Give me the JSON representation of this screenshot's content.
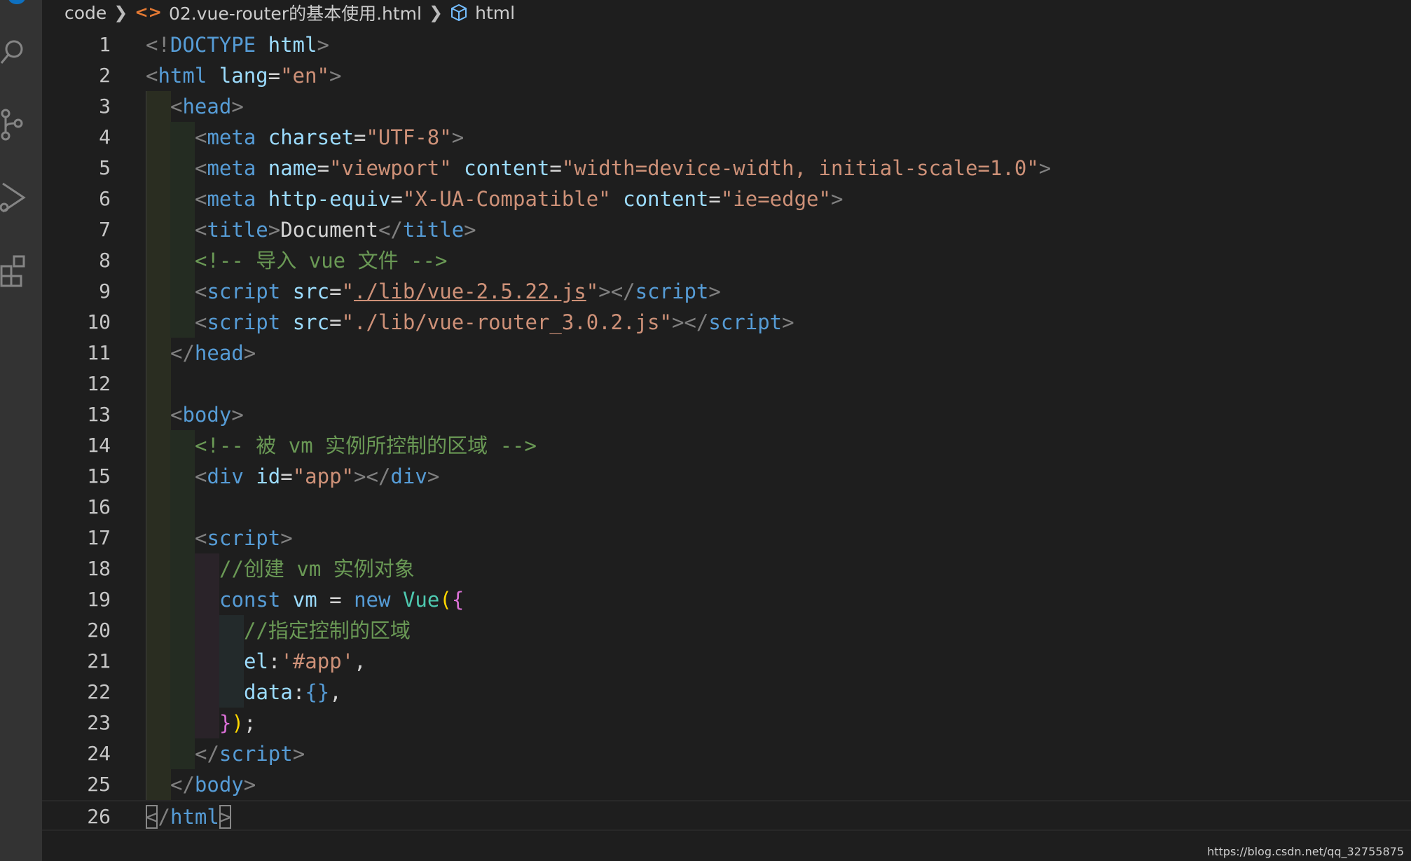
{
  "breadcrumb": {
    "root": "code",
    "file": "02.vue-router的基本使用.html",
    "symbol": "html"
  },
  "icons": {
    "file_icon": "code-bracket-icon",
    "symbol_icon": "cube-icon",
    "activity": [
      "search-icon",
      "source-control-icon",
      "run-debug-icon",
      "extensions-icon"
    ]
  },
  "colors": {
    "background": "#1e1e1e",
    "tag": "#569cd6",
    "attribute": "#9cdcfe",
    "string": "#ce9178",
    "comment": "#6a9955",
    "punctuation": "#808080",
    "class": "#4ec9b0"
  },
  "lines": [
    {
      "n": "1",
      "indent": 0,
      "tokens": [
        [
          "punc",
          "<!"
        ],
        [
          "tag",
          "DOCTYPE"
        ],
        [
          "text",
          " "
        ],
        [
          "attr",
          "html"
        ],
        [
          "punc",
          ">"
        ]
      ]
    },
    {
      "n": "2",
      "indent": 0,
      "tokens": [
        [
          "punc",
          "<"
        ],
        [
          "tag",
          "html"
        ],
        [
          "text",
          " "
        ],
        [
          "attr",
          "lang"
        ],
        [
          "text",
          "="
        ],
        [
          "str",
          "\"en\""
        ],
        [
          "punc",
          ">"
        ]
      ]
    },
    {
      "n": "3",
      "indent": 1,
      "tokens": [
        [
          "punc",
          "<"
        ],
        [
          "tag",
          "head"
        ],
        [
          "punc",
          ">"
        ]
      ]
    },
    {
      "n": "4",
      "indent": 2,
      "tokens": [
        [
          "punc",
          "<"
        ],
        [
          "tag",
          "meta"
        ],
        [
          "text",
          " "
        ],
        [
          "attr",
          "charset"
        ],
        [
          "text",
          "="
        ],
        [
          "str",
          "\"UTF-8\""
        ],
        [
          "punc",
          ">"
        ]
      ]
    },
    {
      "n": "5",
      "indent": 2,
      "tokens": [
        [
          "punc",
          "<"
        ],
        [
          "tag",
          "meta"
        ],
        [
          "text",
          " "
        ],
        [
          "attr",
          "name"
        ],
        [
          "text",
          "="
        ],
        [
          "str",
          "\"viewport\""
        ],
        [
          "text",
          " "
        ],
        [
          "attr",
          "content"
        ],
        [
          "text",
          "="
        ],
        [
          "str",
          "\"width=device-width, initial-scale=1.0\""
        ],
        [
          "punc",
          ">"
        ]
      ]
    },
    {
      "n": "6",
      "indent": 2,
      "tokens": [
        [
          "punc",
          "<"
        ],
        [
          "tag",
          "meta"
        ],
        [
          "text",
          " "
        ],
        [
          "attr",
          "http-equiv"
        ],
        [
          "text",
          "="
        ],
        [
          "str",
          "\"X-UA-Compatible\""
        ],
        [
          "text",
          " "
        ],
        [
          "attr",
          "content"
        ],
        [
          "text",
          "="
        ],
        [
          "str",
          "\"ie=edge\""
        ],
        [
          "punc",
          ">"
        ]
      ]
    },
    {
      "n": "7",
      "indent": 2,
      "tokens": [
        [
          "punc",
          "<"
        ],
        [
          "tag",
          "title"
        ],
        [
          "punc",
          ">"
        ],
        [
          "text",
          "Document"
        ],
        [
          "punc",
          "</"
        ],
        [
          "tag",
          "title"
        ],
        [
          "punc",
          ">"
        ]
      ]
    },
    {
      "n": "8",
      "indent": 2,
      "tokens": [
        [
          "cmt",
          "<!-- 导入 vue 文件 -->"
        ]
      ]
    },
    {
      "n": "9",
      "indent": 2,
      "tokens": [
        [
          "punc",
          "<"
        ],
        [
          "tag",
          "script"
        ],
        [
          "text",
          " "
        ],
        [
          "attr",
          "src"
        ],
        [
          "text",
          "="
        ],
        [
          "str",
          "\""
        ],
        [
          "link",
          "./lib/vue-2.5.22.js"
        ],
        [
          "str",
          "\""
        ],
        [
          "punc",
          "></"
        ],
        [
          "tag",
          "script"
        ],
        [
          "punc",
          ">"
        ]
      ]
    },
    {
      "n": "10",
      "indent": 2,
      "tokens": [
        [
          "punc",
          "<"
        ],
        [
          "tag",
          "script"
        ],
        [
          "text",
          " "
        ],
        [
          "attr",
          "src"
        ],
        [
          "text",
          "="
        ],
        [
          "str",
          "\"./lib/vue-router_3.0.2.js\""
        ],
        [
          "punc",
          "></"
        ],
        [
          "tag",
          "script"
        ],
        [
          "punc",
          ">"
        ]
      ]
    },
    {
      "n": "11",
      "indent": 1,
      "tokens": [
        [
          "punc",
          "</"
        ],
        [
          "tag",
          "head"
        ],
        [
          "punc",
          ">"
        ]
      ]
    },
    {
      "n": "12",
      "indent": 0,
      "tokens": []
    },
    {
      "n": "13",
      "indent": 1,
      "tokens": [
        [
          "punc",
          "<"
        ],
        [
          "tag",
          "body"
        ],
        [
          "punc",
          ">"
        ]
      ]
    },
    {
      "n": "14",
      "indent": 2,
      "tokens": [
        [
          "cmt",
          "<!-- 被 vm 实例所控制的区域 -->"
        ]
      ]
    },
    {
      "n": "15",
      "indent": 2,
      "tokens": [
        [
          "punc",
          "<"
        ],
        [
          "tag",
          "div"
        ],
        [
          "text",
          " "
        ],
        [
          "attr",
          "id"
        ],
        [
          "text",
          "="
        ],
        [
          "str",
          "\"app\""
        ],
        [
          "punc",
          "></"
        ],
        [
          "tag",
          "div"
        ],
        [
          "punc",
          ">"
        ]
      ]
    },
    {
      "n": "16",
      "indent": 0,
      "tokens": []
    },
    {
      "n": "17",
      "indent": 2,
      "tokens": [
        [
          "punc",
          "<"
        ],
        [
          "tag",
          "script"
        ],
        [
          "punc",
          ">"
        ]
      ]
    },
    {
      "n": "18",
      "indent": 3,
      "tokens": [
        [
          "cmt",
          "//创建 vm 实例对象"
        ]
      ]
    },
    {
      "n": "19",
      "indent": 3,
      "tokens": [
        [
          "kw",
          "const"
        ],
        [
          "text",
          " "
        ],
        [
          "var",
          "vm"
        ],
        [
          "text",
          " = "
        ],
        [
          "kw",
          "new"
        ],
        [
          "text",
          " "
        ],
        [
          "cls",
          "Vue"
        ],
        [
          "br1",
          "("
        ],
        [
          "br2",
          "{"
        ]
      ]
    },
    {
      "n": "20",
      "indent": 4,
      "tokens": [
        [
          "cmt",
          "//指定控制的区域"
        ]
      ]
    },
    {
      "n": "21",
      "indent": 4,
      "tokens": [
        [
          "var",
          "el"
        ],
        [
          "text",
          ":"
        ],
        [
          "str",
          "'#app'"
        ],
        [
          "text",
          ","
        ]
      ]
    },
    {
      "n": "22",
      "indent": 4,
      "tokens": [
        [
          "var",
          "data"
        ],
        [
          "text",
          ":"
        ],
        [
          "tag",
          "{}"
        ],
        [
          "text",
          ","
        ]
      ]
    },
    {
      "n": "23",
      "indent": 3,
      "tokens": [
        [
          "br2",
          "}"
        ],
        [
          "br1",
          ")"
        ],
        [
          "text",
          ";"
        ]
      ]
    },
    {
      "n": "24",
      "indent": 2,
      "tokens": [
        [
          "punc",
          "</"
        ],
        [
          "tag",
          "script"
        ],
        [
          "punc",
          ">"
        ]
      ]
    },
    {
      "n": "25",
      "indent": 1,
      "tokens": [
        [
          "punc",
          "</"
        ],
        [
          "tag",
          "body"
        ],
        [
          "punc",
          ">"
        ]
      ]
    },
    {
      "n": "26",
      "indent": 0,
      "tokens": [
        [
          "match",
          "<"
        ],
        [
          "punc",
          "/"
        ],
        [
          "tag",
          "html"
        ],
        [
          "match",
          ">"
        ]
      ]
    }
  ],
  "watermark": "https://blog.csdn.net/qq_32755875"
}
